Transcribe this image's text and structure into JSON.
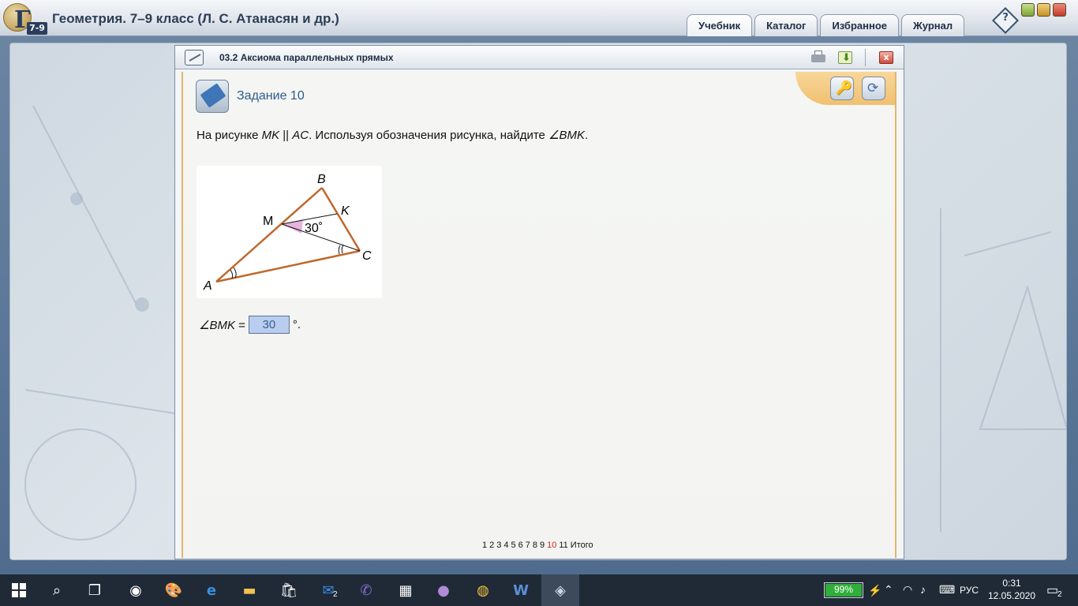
{
  "app": {
    "title": "Геометрия. 7–9 класс (Л. С. Атанасян и др.)",
    "logo_letter": "Г",
    "logo_grade": "7-9",
    "tabs": [
      {
        "label": "Учебник",
        "active": true
      },
      {
        "label": "Каталог",
        "active": false
      },
      {
        "label": "Избранное",
        "active": false
      },
      {
        "label": "Журнал",
        "active": false
      }
    ],
    "help_label": "?"
  },
  "panel": {
    "title": "03.2 Аксиома параллельных прямых",
    "close_label": "x",
    "task_title": "Задание 10",
    "task_text_prefix": "На рисунке ",
    "task_mk": "MK",
    "task_parallel": " || ",
    "task_ac": "AC",
    "task_mid": ". Используя обозначения рисунка, найдите ",
    "task_angle": "∠BMK",
    "task_end": "."
  },
  "figure": {
    "labels": {
      "A": "A",
      "B": "B",
      "C": "C",
      "M": "M",
      "K": "K"
    },
    "angle_label": "30˚"
  },
  "answer": {
    "angle": "∠BMK",
    "equals": " = ",
    "value": "30",
    "unit": "°."
  },
  "pager": {
    "pages": [
      "1",
      "2",
      "3",
      "4",
      "5",
      "6",
      "7",
      "8",
      "9",
      "10",
      "11"
    ],
    "current": "10",
    "total_label": "Итого"
  },
  "taskbar": {
    "battery": "99%",
    "language": "РУС",
    "time": "0:31",
    "date": "12.05.2020",
    "notifications": "2",
    "mail_badge": "2"
  },
  "colors": {
    "triangle": "#c0672c",
    "angle_fill": "#e6b3dd",
    "accent_tab": "#2c3e57",
    "answer_bg": "#b9cdf0",
    "current_page": "#d02a1a",
    "battery": "#2fae3a"
  }
}
